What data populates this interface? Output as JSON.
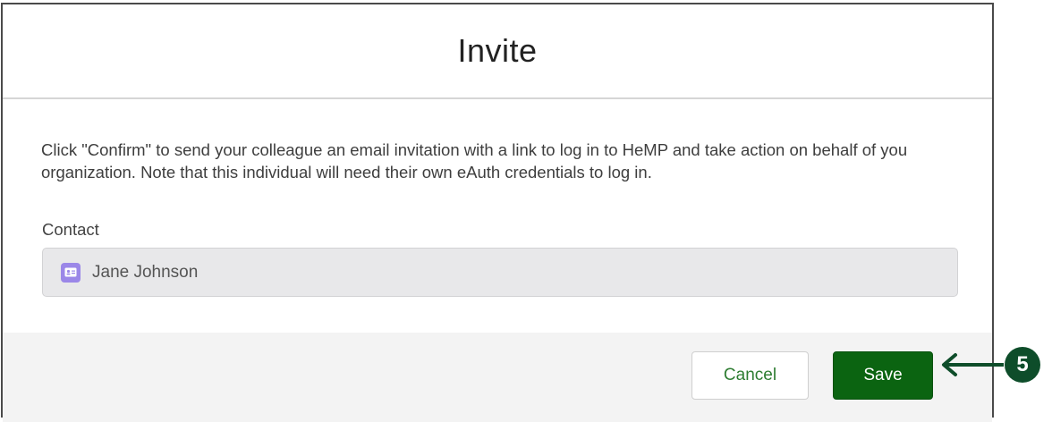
{
  "dialog": {
    "title": "Invite",
    "message": "Click \"Confirm\" to send your colleague an email invitation with a link to log in to HeMP and take action on behalf of you organization. Note that this individual will need their own eAuth credentials to log in.",
    "contact_label": "Contact",
    "contact_value": "Jane Johnson",
    "contact_icon": "contact-card-icon"
  },
  "footer": {
    "cancel_label": "Cancel",
    "save_label": "Save"
  },
  "callout": {
    "number": "5",
    "icon": "arrow-left-icon"
  },
  "colors": {
    "save_bg": "#0b6411",
    "cancel_text": "#2e7d32",
    "contact_icon_bg": "#9b87e8",
    "callout_bg": "#0e4d2a"
  }
}
